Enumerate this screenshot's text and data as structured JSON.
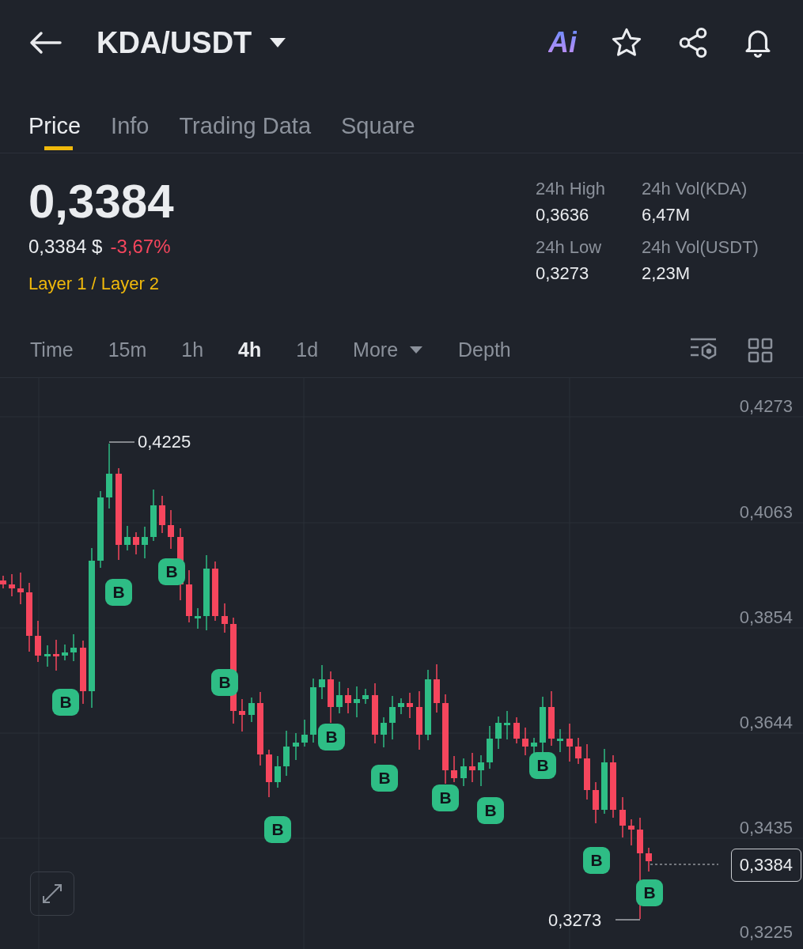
{
  "header": {
    "pair": "KDA/USDT",
    "ai_label": "Ai"
  },
  "tabs": [
    {
      "label": "Price",
      "selected": true
    },
    {
      "label": "Info",
      "selected": false
    },
    {
      "label": "Trading Data",
      "selected": false
    },
    {
      "label": "Square",
      "selected": false
    }
  ],
  "price": {
    "last": "0,3384",
    "fiat": "0,3384 $",
    "change": "-3,67%",
    "category": "Layer 1 / Layer 2"
  },
  "stats": [
    {
      "label": "24h High",
      "value": "0,3636"
    },
    {
      "label": "24h Vol(KDA)",
      "value": "6,47M"
    },
    {
      "label": "24h Low",
      "value": "0,3273"
    },
    {
      "label": "24h Vol(USDT)",
      "value": "2,23M"
    }
  ],
  "intervals": [
    {
      "label": "Time",
      "selected": false,
      "kind": "plain"
    },
    {
      "label": "15m",
      "selected": false,
      "kind": "plain"
    },
    {
      "label": "1h",
      "selected": false,
      "kind": "plain"
    },
    {
      "label": "4h",
      "selected": true,
      "kind": "plain"
    },
    {
      "label": "1d",
      "selected": false,
      "kind": "plain"
    },
    {
      "label": "More",
      "selected": false,
      "kind": "dropdown"
    },
    {
      "label": "Depth",
      "selected": false,
      "kind": "plain"
    }
  ],
  "chart": {
    "price_axis": [
      "0,4273",
      "0,4063",
      "0,3854",
      "0,3644",
      "0,3435",
      "0,3225"
    ],
    "high_label": "0,4225",
    "low_label": "0,3273",
    "current_price": "0,3384",
    "buy_markers": [
      "B",
      "B",
      "B",
      "B",
      "B",
      "B",
      "B",
      "B",
      "B",
      "B",
      "B",
      "B"
    ]
  }
}
